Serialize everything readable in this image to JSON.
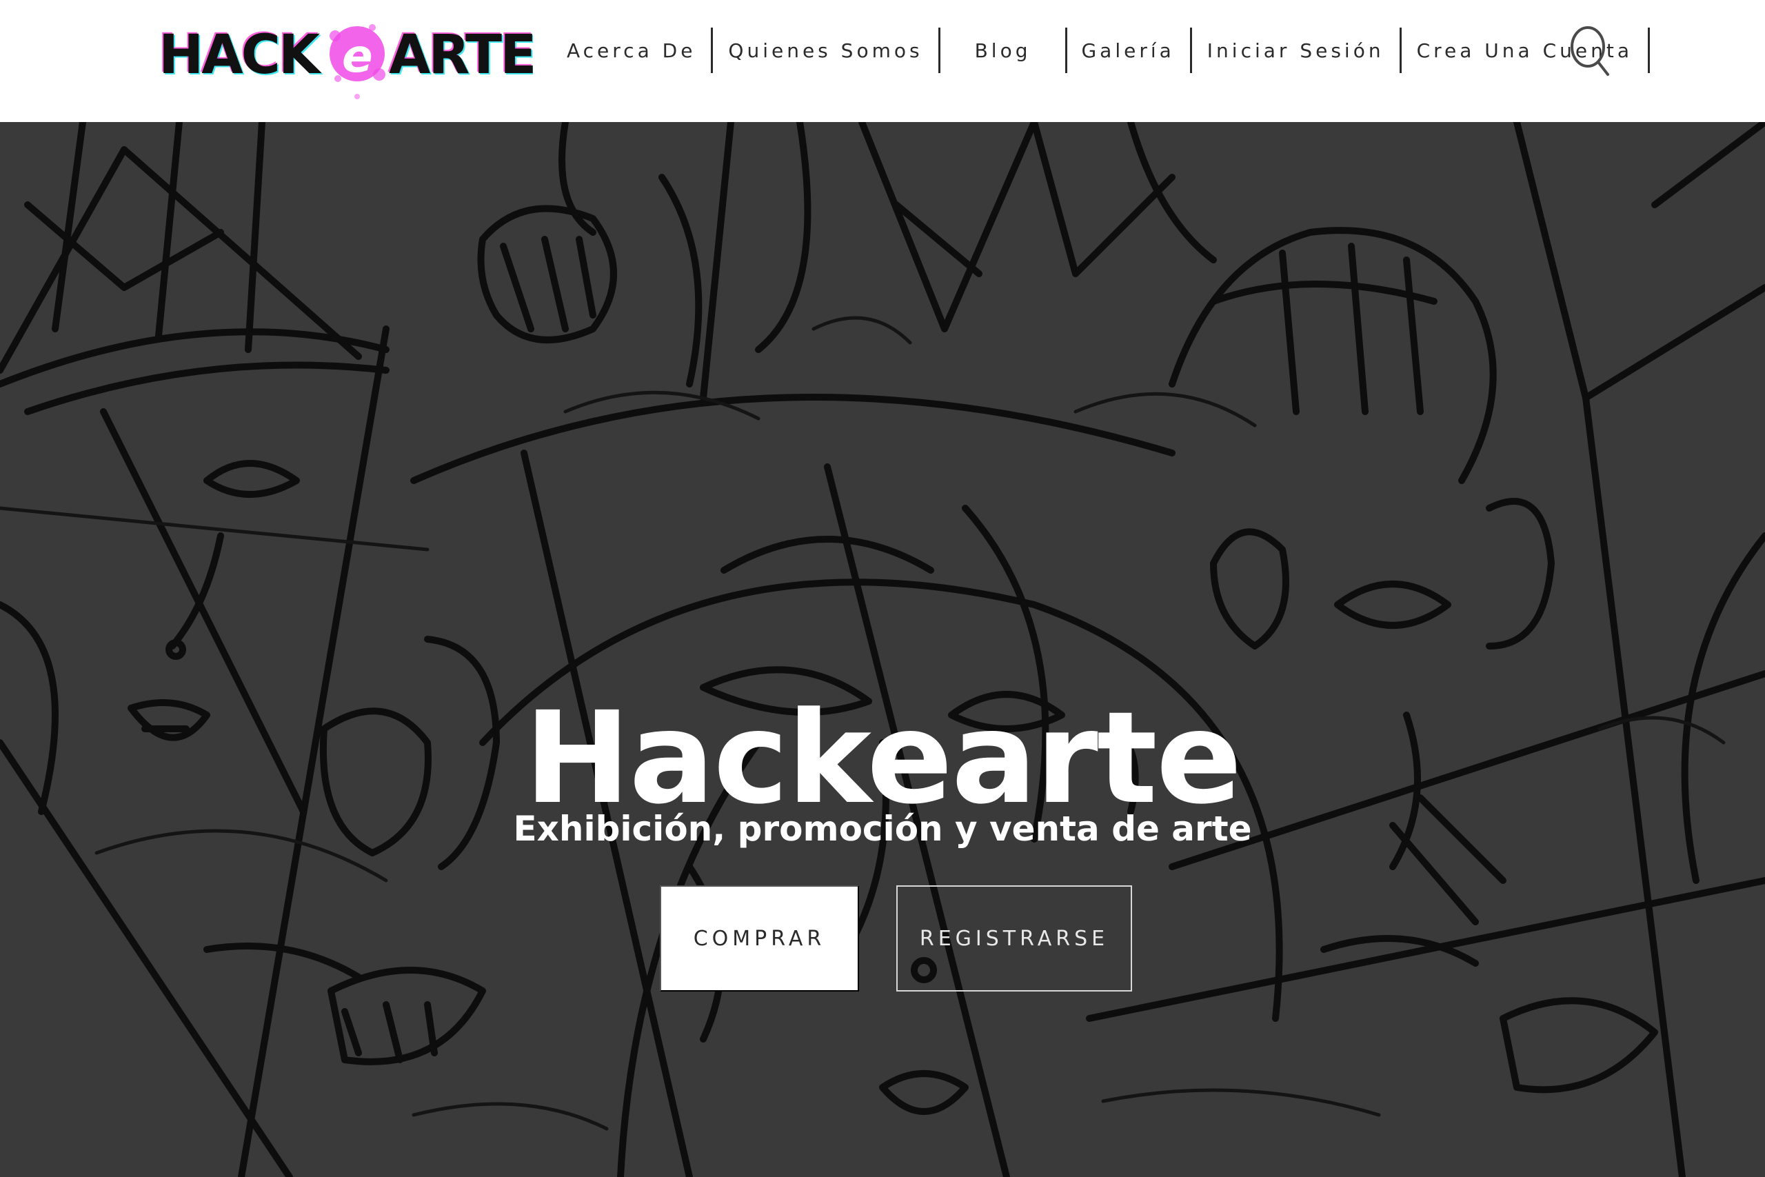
{
  "brand": {
    "logo_text": "HACKeARTE",
    "logo_prefix": "HACK",
    "logo_letter": "e",
    "logo_suffix": "ARTE",
    "colors": {
      "logo_text": "#111111",
      "logo_cyan": "#2ee6f0",
      "logo_magenta": "#ff2bd0",
      "logo_splash": "#f04ae8"
    }
  },
  "nav": {
    "items": [
      {
        "label": "Acerca De"
      },
      {
        "label": "Quienes Somos"
      },
      {
        "label": "Blog"
      },
      {
        "label": "Galería"
      },
      {
        "label": "Iniciar Sesión"
      },
      {
        "label": "Crea Una Cuenta"
      }
    ],
    "search_icon": "search-icon"
  },
  "hero": {
    "title": "Hackearte",
    "subtitle": "Exhibición, promoción y venta de arte",
    "background_color": "#3a3a3a",
    "primary_button": "COMPRAR",
    "secondary_button": "REGISTRARSE"
  }
}
